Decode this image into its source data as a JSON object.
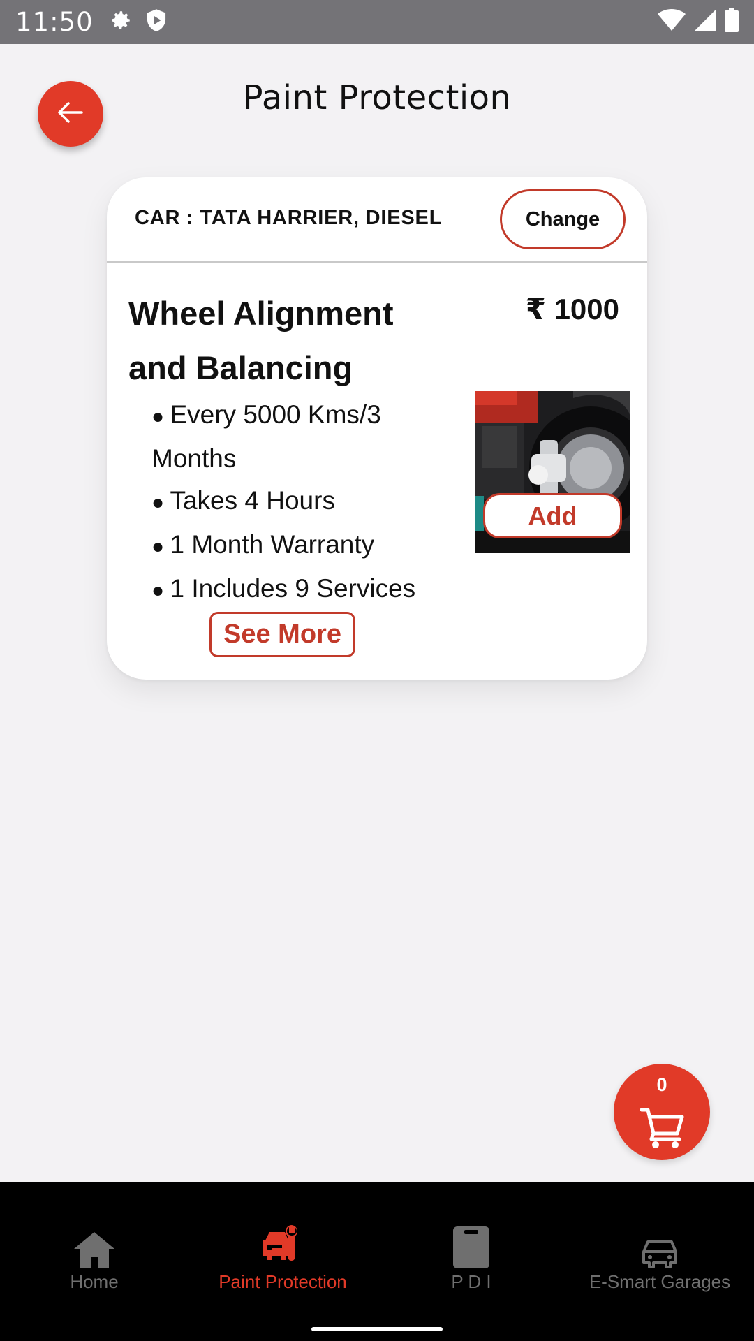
{
  "status_bar": {
    "time": "11:50",
    "left_icons": [
      "gear-icon",
      "shield-icon"
    ],
    "right_icons": [
      "wifi-icon",
      "signal-icon",
      "battery-icon"
    ]
  },
  "header": {
    "title": "Paint Protection",
    "back_icon": "arrow-left-icon"
  },
  "card": {
    "car_label": "CAR : TATA HARRIER, DIESEL",
    "change_label": "Change",
    "service_name": "Wheel Alignment and Balancing",
    "price": "₹ 1000",
    "features": [
      " Every 5000 Kms/3 Months",
      "Takes 4 Hours",
      "1 Month Warranty",
      "1 Includes 9 Services"
    ],
    "add_label": "Add",
    "see_more_label": "See More"
  },
  "cart": {
    "count": "0",
    "icon": "cart-icon"
  },
  "bottom_nav": {
    "items": [
      {
        "label": "Home",
        "icon": "home-icon",
        "active": false
      },
      {
        "label": "Paint Protection",
        "icon": "car-service-icon",
        "active": true
      },
      {
        "label": "P D I",
        "icon": "clipboard-icon",
        "active": false
      },
      {
        "label": "E-Smart Garages",
        "icon": "car-icon",
        "active": false
      }
    ]
  },
  "colors": {
    "accent": "#e13a28",
    "border_red": "#c23a2a",
    "status_bar": "#747377",
    "background": "#f3f2f4",
    "nav_background": "#000000",
    "nav_inactive": "#6f6f6f"
  }
}
